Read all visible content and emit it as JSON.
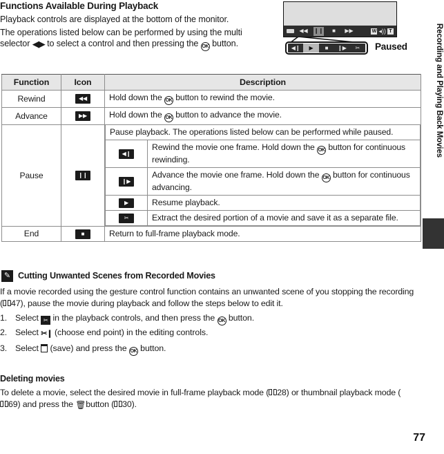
{
  "page": {
    "number": "77",
    "chapter_label": "Recording and Playing Back Movies"
  },
  "section": {
    "title": "Functions Available During Playback",
    "intro_line1": "Playback controls are displayed at the bottom of the monitor.",
    "intro_line2_a": "The operations listed below can be performed by using the",
    "intro_line2_b": "multi selector",
    "intro_line2_c": "to select a control and then pressing the",
    "intro_line2_d": "button."
  },
  "illustration": {
    "name": "camera-monitor-playback-controls",
    "monitor_bar": {
      "battery": "battery-icon",
      "controls": [
        {
          "name": "rewind",
          "glyph": "◀◀",
          "selected": false
        },
        {
          "name": "pause",
          "glyph": "❙❙",
          "selected": true
        },
        {
          "name": "stop",
          "glyph": "■",
          "selected": false
        },
        {
          "name": "advance",
          "glyph": "▶▶",
          "selected": false
        }
      ],
      "right_indicators": [
        {
          "name": "wide-zoom",
          "label": "W"
        },
        {
          "name": "volume-speaker",
          "label": "◂))"
        },
        {
          "name": "tele-zoom",
          "label": "T"
        }
      ]
    },
    "enlarged_strip": {
      "buttons": [
        {
          "name": "frame-rewind",
          "glyph": "◀❙",
          "selected": false
        },
        {
          "name": "resume-play",
          "glyph": "▶",
          "selected": true
        },
        {
          "name": "end",
          "glyph": "■",
          "selected": false
        },
        {
          "name": "frame-advance",
          "glyph": "❙▶",
          "selected": false
        },
        {
          "name": "extract-scissors",
          "glyph": "✂",
          "selected": false
        }
      ]
    },
    "caption": "Paused"
  },
  "table": {
    "headers": [
      "Function",
      "Icon",
      "Description"
    ],
    "rows": [
      {
        "function": "Rewind",
        "icon_glyph": "◀◀",
        "icon_name": "rewind-icon",
        "desc_a": "Hold down the",
        "desc_b": "button to rewind the movie."
      },
      {
        "function": "Advance",
        "icon_glyph": "▶▶",
        "icon_name": "advance-icon",
        "desc_a": "Hold down the",
        "desc_b": "button to advance the movie."
      }
    ],
    "pause_row": {
      "function": "Pause",
      "icon_glyph": "❙❙",
      "icon_name": "pause-icon",
      "lead_desc": "Pause playback. The operations listed below can be performed while paused.",
      "sub_rows": [
        {
          "icon_glyph": "◀❙",
          "icon_name": "frame-rewind-icon",
          "desc_a": "Rewind the movie one frame. Hold down the",
          "desc_b": "button for continuous rewinding."
        },
        {
          "icon_glyph": "❙▶",
          "icon_name": "frame-advance-icon",
          "desc_a": "Advance the movie one frame. Hold down the",
          "desc_b": "button for continuous advancing."
        },
        {
          "icon_glyph": "▶",
          "icon_name": "resume-play-icon",
          "desc_a": "Resume playback.",
          "desc_b": ""
        },
        {
          "icon_glyph": "✂",
          "icon_name": "extract-scissors-icon",
          "desc_a": "Extract the desired portion of a movie and save it as a separate file.",
          "desc_b": ""
        }
      ]
    },
    "end_row": {
      "function": "End",
      "icon_glyph": "■",
      "icon_name": "end-stop-icon",
      "desc": "Return to full-frame playback mode."
    }
  },
  "note": {
    "icon_name": "pencil-note-icon",
    "title": "Cutting Unwanted Scenes from Recorded Movies",
    "body_a": "If a movie recorded using the gesture control function contains an unwanted scene of you stopping the recording (",
    "body_ref": "47",
    "body_b": "), pause the movie during playback and follow the steps below to edit it.",
    "steps": [
      {
        "num": "1.",
        "text_a": "Select",
        "icon_name": "extract-scissors-icon",
        "icon_glyph": "✂",
        "text_b": "in the playback controls, and then press the",
        "text_c": "button."
      },
      {
        "num": "2.",
        "text_a": "Select",
        "icon_name": "choose-end-point-icon",
        "icon_glyph": "✂❙",
        "text_b": "(choose end point) in the editing controls.",
        "text_c": ""
      },
      {
        "num": "3.",
        "text_a": "Select",
        "icon_name": "save-icon",
        "icon_glyph": "",
        "text_b": "(save) and press the",
        "text_c": "button."
      }
    ]
  },
  "deleting": {
    "title": "Deleting movies",
    "text_a": "To delete a movie, select the desired movie in full-frame playback mode (",
    "ref1": "28",
    "text_b": ") or thumbnail playback mode (",
    "ref2": "69",
    "text_c": ") and press the",
    "trash_icon": "trash-icon",
    "text_d": "button (",
    "ref3": "30",
    "text_e": ")."
  },
  "glyphs": {
    "ok_button": "OK",
    "multi_selector": "◀▶"
  }
}
